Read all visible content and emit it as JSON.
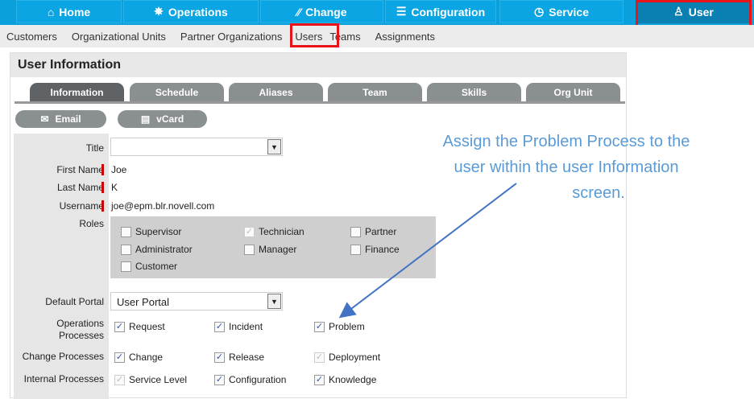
{
  "topnav": {
    "items": [
      {
        "label": "Home",
        "icon": "home-icon"
      },
      {
        "label": "Operations",
        "icon": "helm-icon"
      },
      {
        "label": "Change",
        "icon": "change-icon"
      },
      {
        "label": "Configuration",
        "icon": "sliders-icon"
      },
      {
        "label": "Service",
        "icon": "clock-icon"
      },
      {
        "label": "User",
        "icon": "user-icon"
      }
    ],
    "active": "User"
  },
  "subnav": {
    "items": [
      "Customers",
      "Organizational Units",
      "Partner Organizations",
      "Users",
      "Teams",
      "Assignments"
    ],
    "active": "Users"
  },
  "panel": {
    "title": "User Information",
    "tabs": [
      "Information",
      "Schedule",
      "Aliases",
      "Team",
      "Skills",
      "Org Unit"
    ],
    "buttons": {
      "email": "Email",
      "vcard": "vCard"
    },
    "form": {
      "title_label": "Title",
      "title_value": "",
      "first_name_label": "First Name",
      "first_name": "Joe",
      "last_name_label": "Last Name",
      "last_name": "K",
      "username_label": "Username",
      "username": "joe@epm.blr.novell.com",
      "roles_label": "Roles",
      "roles": [
        {
          "label": "Supervisor",
          "checked": false
        },
        {
          "label": "Technician",
          "checked": true,
          "disabled": true
        },
        {
          "label": "Partner",
          "checked": false
        },
        {
          "label": "Administrator",
          "checked": false
        },
        {
          "label": "Manager",
          "checked": false
        },
        {
          "label": "Finance",
          "checked": false
        },
        {
          "label": "Customer",
          "checked": false
        }
      ],
      "portal_label": "Default Portal",
      "portal_value": "User Portal",
      "ops_label_1": "Operations",
      "ops_label_2": "Processes",
      "ops": [
        {
          "label": "Request",
          "checked": true
        },
        {
          "label": "Incident",
          "checked": true
        },
        {
          "label": "Problem",
          "checked": true
        }
      ],
      "change_label": "Change Processes",
      "change": [
        {
          "label": "Change",
          "checked": true
        },
        {
          "label": "Release",
          "checked": true
        },
        {
          "label": "Deployment",
          "checked": true,
          "disabled": true
        }
      ],
      "internal_label": "Internal Processes",
      "internal": [
        {
          "label": "Service Level",
          "checked": true,
          "disabled": true
        },
        {
          "label": "Configuration",
          "checked": true
        },
        {
          "label": "Knowledge",
          "checked": true
        }
      ]
    }
  },
  "annotation": {
    "lines": [
      "Assign the Problem Process to the",
      "user within the user Information",
      "screen."
    ],
    "color": "#5b9bd5"
  }
}
